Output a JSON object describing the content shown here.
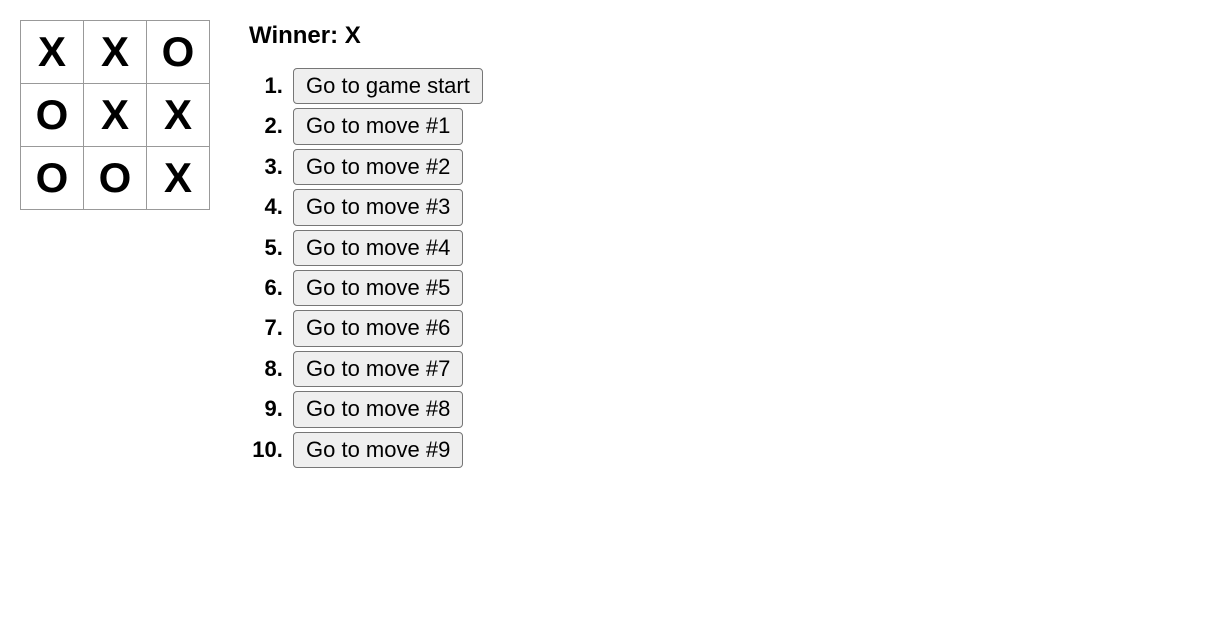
{
  "board": {
    "squares": [
      "X",
      "X",
      "O",
      "O",
      "X",
      "X",
      "O",
      "O",
      "X"
    ]
  },
  "status": "Winner: X",
  "history": [
    "Go to game start",
    "Go to move #1",
    "Go to move #2",
    "Go to move #3",
    "Go to move #4",
    "Go to move #5",
    "Go to move #6",
    "Go to move #7",
    "Go to move #8",
    "Go to move #9"
  ]
}
